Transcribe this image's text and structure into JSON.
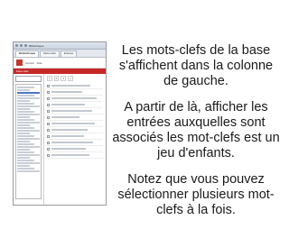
{
  "screenshot": {
    "window_title": "Bibliothèque",
    "tabs": [
      "Bibliothèque",
      "Mots-clefs",
      "Entrées"
    ],
    "header_links": [
      "Accueil",
      "Aide"
    ],
    "redbar_text": "Mots-clefs",
    "keyword_input_placeholder": "",
    "pager": [
      "1",
      "2",
      "3",
      "»"
    ]
  },
  "description": {
    "paragraphs": [
      "Les mots-clefs de la base s'affichent dans la colonne de gauche.",
      "A partir de là, afficher les entrées auxquelles sont associés les mot-clefs est un jeu d'enfants.",
      "Notez que vous pouvez sélectionner plusieurs mot-clefs à la fois."
    ]
  }
}
